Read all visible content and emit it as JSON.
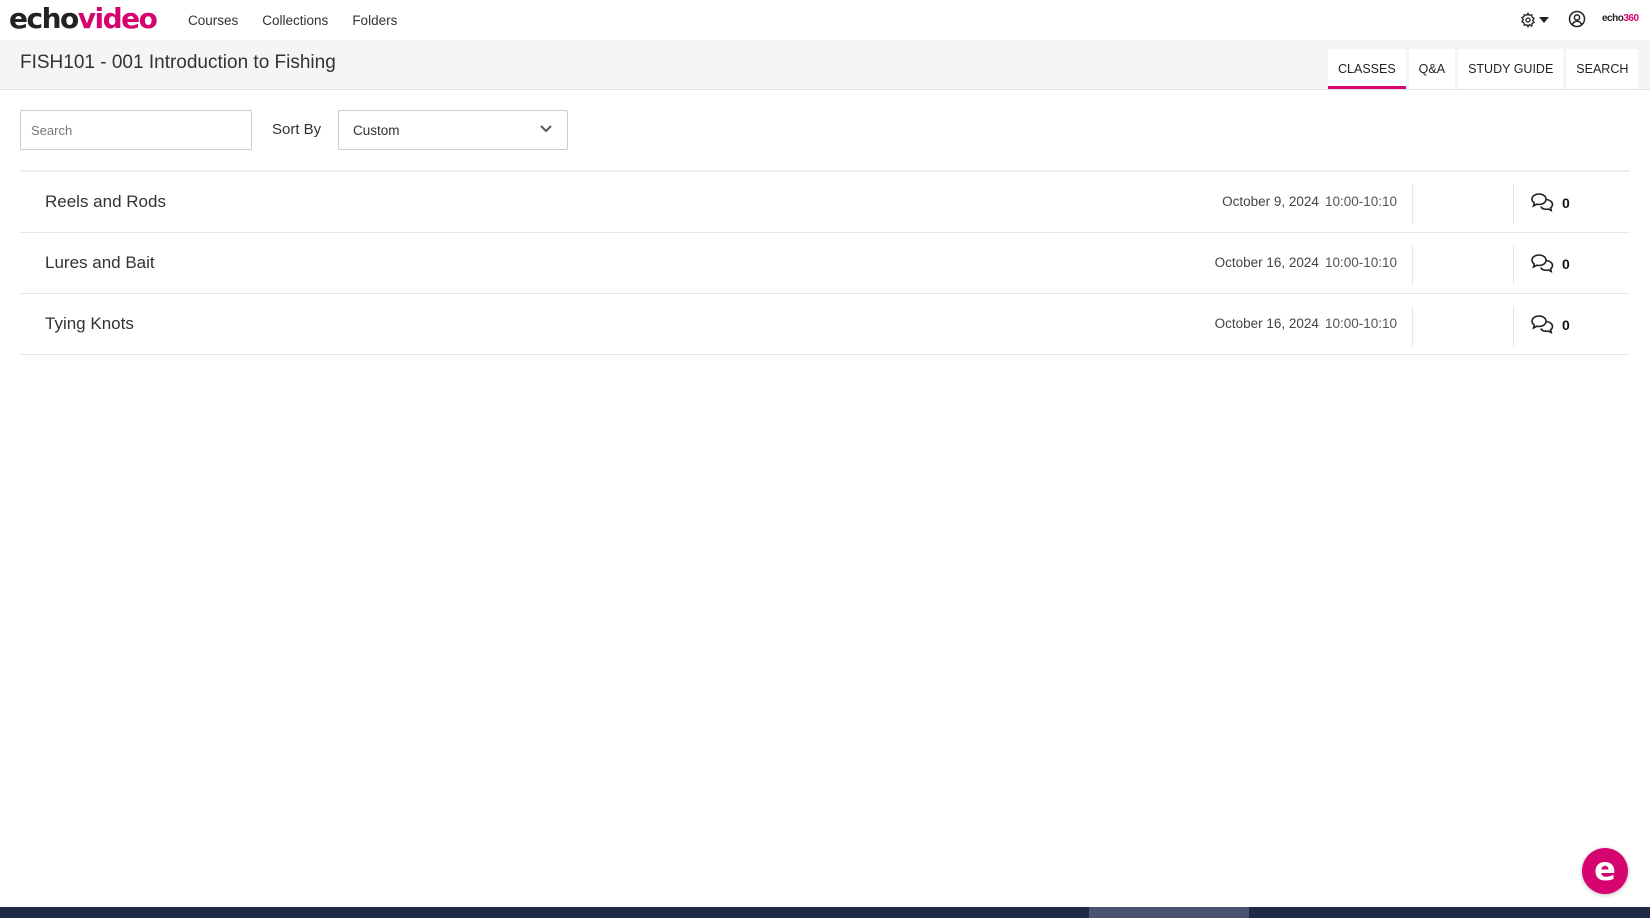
{
  "brand": {
    "logo_part1": "echo",
    "logo_part2": "video",
    "small_part1": "echo",
    "small_part2": "360"
  },
  "nav": {
    "items": [
      "Courses",
      "Collections",
      "Folders"
    ]
  },
  "header_icons": {
    "settings": "gear-icon",
    "settings_menu": "caret-down-icon",
    "account": "user-circle-icon"
  },
  "course": {
    "title": "FISH101 - 001 Introduction to Fishing"
  },
  "tabs": [
    {
      "label": "CLASSES",
      "active": true
    },
    {
      "label": "Q&A",
      "active": false
    },
    {
      "label": "STUDY GUIDE",
      "active": false
    },
    {
      "label": "SEARCH",
      "active": false
    }
  ],
  "filters": {
    "search_placeholder": "Search",
    "search_value": "",
    "sort_label": "Sort By",
    "sort_value": "Custom"
  },
  "classes": [
    {
      "title": "Reels and Rods",
      "date": "October 9, 2024",
      "time": "10:00-10:10",
      "qa_count": "0"
    },
    {
      "title": "Lures and Bait",
      "date": "October 16, 2024",
      "time": "10:00-10:10",
      "qa_count": "0"
    },
    {
      "title": "Tying Knots",
      "date": "October 16, 2024",
      "time": "10:00-10:10",
      "qa_count": "0"
    }
  ],
  "fab": {
    "glyph": "e"
  },
  "colors": {
    "accent": "#d6046f",
    "taskbar": "#1f2a44"
  }
}
